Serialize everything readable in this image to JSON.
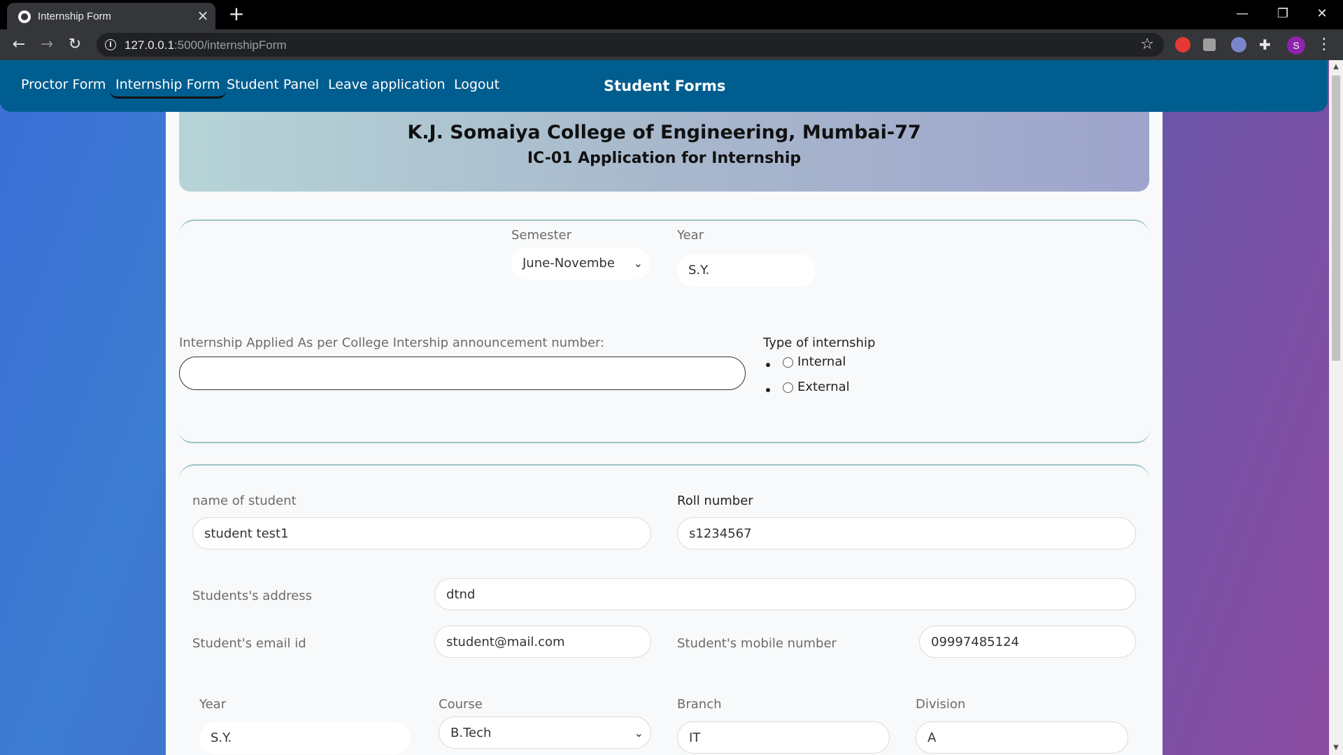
{
  "browser": {
    "tab_title": "Internship Form",
    "url_host": "127.0.0.1",
    "url_path": ":5000/internshipForm",
    "profile_initial": "S"
  },
  "nav": {
    "links": [
      "Proctor Form",
      "Internship Form",
      "Student Panel",
      "Leave application",
      "Logout"
    ],
    "active": "Internship Form",
    "brand": "Student Forms"
  },
  "header": {
    "college": "K.J. Somaiya College of Engineering, Mumbai-77",
    "form_title": "IC-01 Application for Internship"
  },
  "semester_section": {
    "semester_label": "Semester",
    "semester_value": "June-Novembe",
    "year_label": "Year",
    "year_value": "S.Y."
  },
  "internship": {
    "announcement_label": "Internship Applied As per College Intership announcement number:",
    "announcement_value": "",
    "type_label": "Type of internship",
    "type_options": [
      "Internal",
      "External"
    ]
  },
  "student": {
    "name_label": "name of student",
    "name_value": "student test1",
    "roll_label": "Roll number",
    "roll_value": "s1234567",
    "address_label": "Students's address",
    "address_value": "dtnd",
    "email_label": "Student's email id",
    "email_value": "student@mail.com",
    "mobile_label": "Student's mobile number",
    "mobile_value": "09997485124",
    "year_label": "Year",
    "year_value": "S.Y.",
    "course_label": "Course",
    "course_value": "B.Tech",
    "branch_label": "Branch",
    "branch_value": "IT",
    "division_label": "Division",
    "division_value": "A"
  },
  "colors": {
    "nav_bg": "#005d8f",
    "accent_border": "#9cc4c4"
  }
}
